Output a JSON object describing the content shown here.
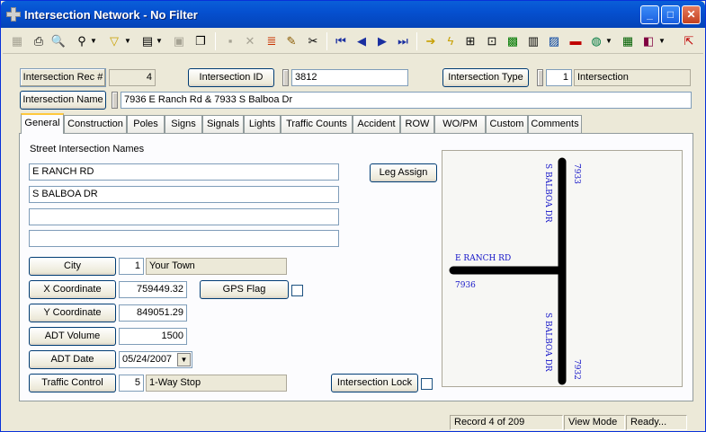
{
  "window": {
    "title": "Intersection Network - No Filter"
  },
  "header": {
    "rec_label": "Intersection Rec #",
    "rec_value": "4",
    "id_label": "Intersection ID",
    "id_value": "3812",
    "type_label": "Intersection Type",
    "type_code": "1",
    "type_value": "Intersection",
    "name_label": "Intersection Name",
    "name_value": "7936 E Ranch Rd & 7933 S Balboa Dr"
  },
  "tabs": [
    "General",
    "Construction",
    "Poles",
    "Signs",
    "Signals",
    "Lights",
    "Traffic Counts",
    "Accident",
    "ROW",
    "WO/PM",
    "Custom",
    "Comments"
  ],
  "general": {
    "street_names_label": "Street Intersection Names",
    "streets": [
      "E RANCH RD",
      "S BALBOA DR",
      "",
      ""
    ],
    "leg_assign": "Leg Assign",
    "city_label": "City",
    "city_code": "1",
    "city_value": "Your Town",
    "x_label": "X Coordinate",
    "x_value": "759449.32",
    "y_label": "Y Coordinate",
    "y_value": "849051.29",
    "adt_label": "ADT Volume",
    "adt_value": "1500",
    "adt_date_label": "ADT Date",
    "adt_date_value": "05/24/2007",
    "traffic_control_label": "Traffic Control",
    "traffic_control_code": "5",
    "traffic_control_value": "1-Way Stop",
    "gps_flag": "GPS Flag",
    "intersection_lock": "Intersection Lock"
  },
  "map": {
    "road_top_label": "S BALBOA DR",
    "road_top_num": "7933",
    "road_left_label": "E RANCH RD",
    "road_left_num": "7936",
    "road_bottom_label": "S BALBOA DR",
    "road_bottom_num": "7932",
    "road_color": "#000000",
    "label_color": "#1414c8"
  },
  "status": {
    "record": "Record 4 of 209",
    "mode": "View Mode",
    "state": "Ready..."
  }
}
